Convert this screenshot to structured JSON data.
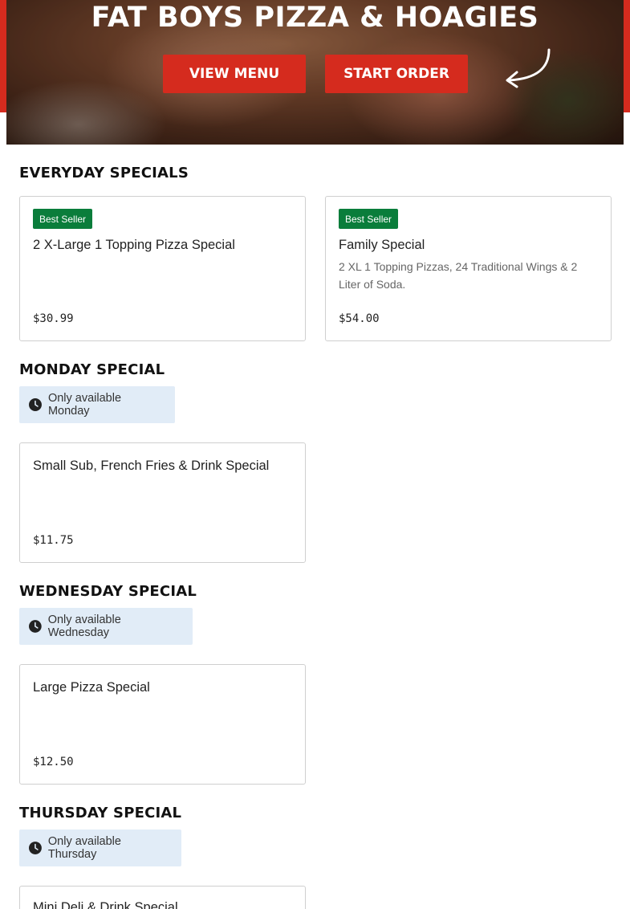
{
  "hero": {
    "title": "FAT BOYS PIZZA & HOAGIES",
    "view_menu_label": "VIEW MENU",
    "start_order_label": "START ORDER",
    "icons": {
      "arrow": "curved-arrow-icon"
    }
  },
  "sections": {
    "everyday": {
      "title": "EVERYDAY SPECIALS",
      "items": [
        {
          "badge": "Best Seller",
          "name": "2 X-Large 1 Topping Pizza Special",
          "description": "",
          "price": "$30.99"
        },
        {
          "badge": "Best Seller",
          "name": "Family Special",
          "description": "2 XL 1 Topping Pizzas, 24 Traditional Wings & 2 Liter of Soda.",
          "price": "$54.00"
        }
      ]
    },
    "monday": {
      "title": "MONDAY SPECIAL",
      "availability": "Only available Monday",
      "items": [
        {
          "name": "Small Sub, French Fries & Drink Special",
          "price": "$11.75"
        }
      ]
    },
    "wednesday": {
      "title": "WEDNESDAY SPECIAL",
      "availability": "Only available Wednesday",
      "items": [
        {
          "name": "Large Pizza Special",
          "price": "$12.50"
        }
      ]
    },
    "thursday": {
      "title": "THURSDAY SPECIAL",
      "availability": "Only available Thursday",
      "items": [
        {
          "name": "Mini Deli & Drink Special"
        }
      ]
    }
  },
  "colors": {
    "brand_red": "#d52b1e",
    "badge_green": "#0a7d3b",
    "availability_bg": "#e1ecf7"
  },
  "icons": {
    "availability": "clock-icon"
  }
}
